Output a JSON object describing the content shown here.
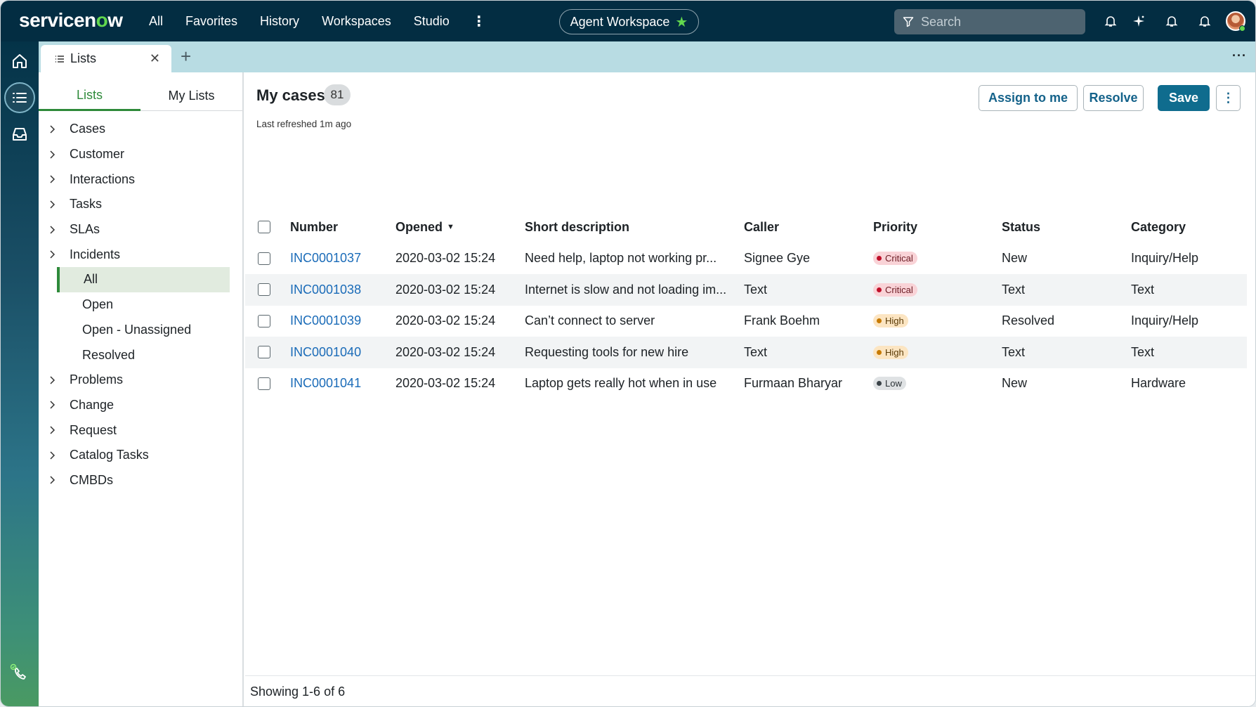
{
  "nav": {
    "logo_prefix": "servicen",
    "logo_o": "o",
    "logo_suffix": "w",
    "menu": [
      "All",
      "Favorites",
      "History",
      "Workspaces",
      "Studio"
    ],
    "workspace_label": "Agent Workspace",
    "search_placeholder": "Search"
  },
  "tabs": {
    "active_label": "Lists"
  },
  "sidebar": {
    "tabs": [
      "Lists",
      "My Lists"
    ],
    "items": [
      {
        "label": "Cases"
      },
      {
        "label": "Customer"
      },
      {
        "label": "Interactions"
      },
      {
        "label": "Tasks"
      },
      {
        "label": "SLAs"
      },
      {
        "label": "Incidents"
      }
    ],
    "incident_subitems": [
      "All",
      "Open",
      "Open - Unassigned",
      "Resolved"
    ],
    "items_after": [
      {
        "label": "Problems"
      },
      {
        "label": "Change"
      },
      {
        "label": "Request"
      },
      {
        "label": "Catalog Tasks"
      },
      {
        "label": "CMBDs"
      }
    ]
  },
  "main": {
    "title": "My cases",
    "count": "81",
    "refreshed": "Last refreshed 1m ago",
    "buttons": {
      "assign": "Assign to me",
      "resolve": "Resolve",
      "save": "Save"
    },
    "columns": [
      "Number",
      "Opened",
      "Short description",
      "Caller",
      "Priority",
      "Status",
      "Category"
    ],
    "rows": [
      {
        "number": "INC0001037",
        "opened": "2020-03-02 15:24",
        "desc": "Need help, laptop not working pr...",
        "caller": "Signee Gye",
        "priority": "Critical",
        "status": "New",
        "category": "Inquiry/Help"
      },
      {
        "number": "INC0001038",
        "opened": "2020-03-02 15:24",
        "desc": "Internet is slow and not loading im...",
        "caller": "Text",
        "priority": "Critical",
        "status": "Text",
        "category": "Text"
      },
      {
        "number": "INC0001039",
        "opened": "2020-03-02 15:24",
        "desc": "Can’t connect to server",
        "caller": "Frank Boehm",
        "priority": "High",
        "status": "Resolved",
        "category": "Inquiry/Help"
      },
      {
        "number": "INC0001040",
        "opened": "2020-03-02 15:24",
        "desc": "Requesting tools for new hire",
        "caller": "Text",
        "priority": "High",
        "status": "Text",
        "category": "Text"
      },
      {
        "number": "INC0001041",
        "opened": "2020-03-02 15:24",
        "desc": "Laptop gets really hot when in use",
        "caller": "Furmaan Bharyar",
        "priority": "Low",
        "status": "New",
        "category": "Hardware"
      }
    ],
    "footer": "Showing 1-6 of 6"
  },
  "colors": {
    "nav_bg": "#032d42",
    "accent_green": "#2e8a3a",
    "primary_button": "#0f6c8e",
    "link": "#1a6bb8"
  }
}
